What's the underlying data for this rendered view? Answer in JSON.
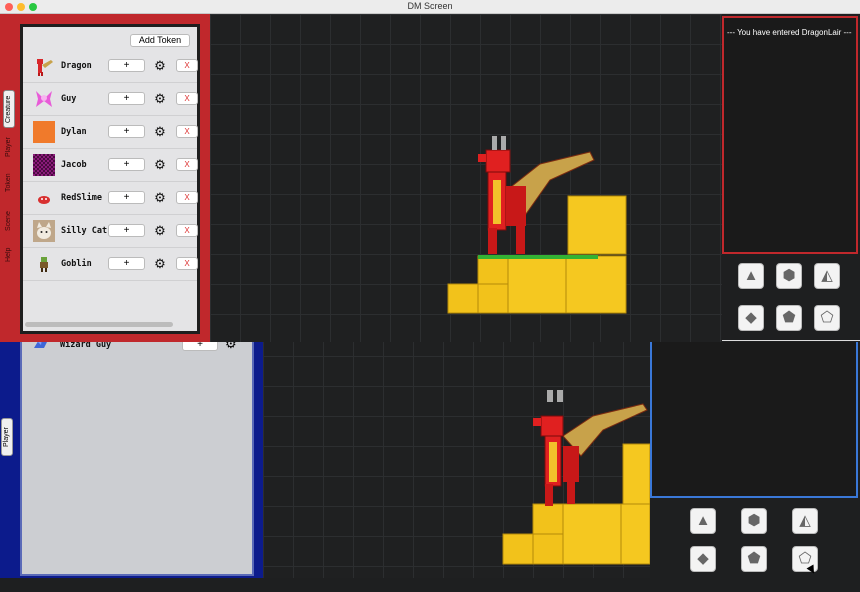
{
  "window": {
    "title": "DM Screen"
  },
  "side_tabs": [
    "Creature",
    "Player",
    "Token",
    "Scene",
    "Help"
  ],
  "token_panel": {
    "add_button": "Add Token",
    "plus_label": "+",
    "delete_label": "X",
    "tokens": [
      {
        "name": "Dragon",
        "icon": "dragon-icon",
        "color": "#d8262a"
      },
      {
        "name": "Guy",
        "icon": "pink-figure-icon",
        "color": "#e85bd8"
      },
      {
        "name": "Dylan",
        "icon": "orange-square-icon",
        "color": "#f07a2b"
      },
      {
        "name": "Jacob",
        "icon": "purple-checker-icon",
        "color": "#8a1a7a"
      },
      {
        "name": "RedSlime",
        "icon": "red-slime-icon",
        "color": "#d83030"
      },
      {
        "name": "Silly Cat",
        "icon": "cat-photo-icon",
        "color": "#c9b49a"
      },
      {
        "name": "Goblin",
        "icon": "goblin-icon",
        "color": "#3f7a2a"
      }
    ]
  },
  "chat": {
    "message": "--- You have entered DragonLair ---"
  },
  "dice": [
    "d4-icon",
    "d6-icon",
    "d8-icon",
    "d10-icon",
    "d12-icon",
    "d20-icon"
  ],
  "player_window": {
    "side_tab": "Player",
    "token": {
      "name": "Wizard Guy",
      "icon": "wizard-icon",
      "plus_label": "+"
    }
  },
  "colors": {
    "dm_accent": "#c0282c",
    "player_accent": "#0c1b8c",
    "chat_player_border": "#3a78d8"
  }
}
